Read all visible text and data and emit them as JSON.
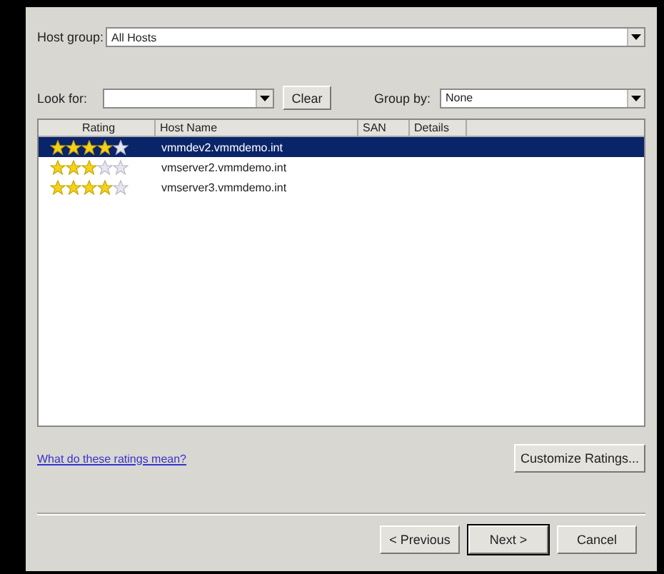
{
  "host_group": {
    "label": "Host group:",
    "value": "All Hosts"
  },
  "look_for": {
    "label": "Look for:"
  },
  "clear_button": "Clear",
  "group_by": {
    "label": "Group by:",
    "value": "None"
  },
  "table": {
    "columns": [
      "Rating",
      "Host Name",
      "SAN",
      "Details"
    ],
    "rows": [
      {
        "stars": 4,
        "host_name": "vmmdev2.vmmdemo.int",
        "selected": true
      },
      {
        "stars": 3,
        "host_name": "vmserver2.vmmdemo.int",
        "selected": false
      },
      {
        "stars": 4,
        "host_name": "vmserver3.vmmdemo.int",
        "selected": false
      }
    ]
  },
  "help_link": "What do these ratings mean?",
  "customize_button": "Customize Ratings...",
  "buttons": [
    {
      "label": "< Previous",
      "kind": "normal"
    },
    {
      "label": "Next >",
      "kind": "default"
    },
    {
      "label": "Cancel",
      "kind": "normal"
    }
  ]
}
